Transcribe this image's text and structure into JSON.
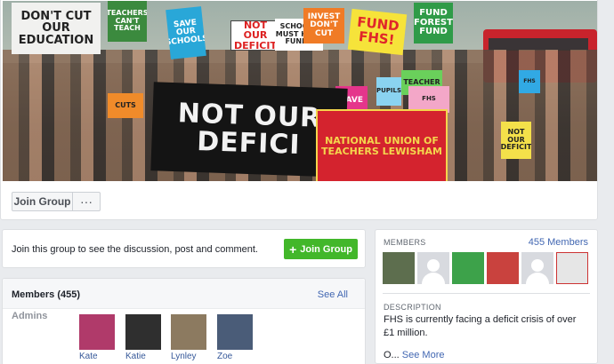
{
  "cover": {
    "banner_lines": [
      "NOT OUR",
      "DEFICI"
    ],
    "union_banner": "NATIONAL UNION OF TEACHERS LEWISHAM",
    "signs": [
      "DON'T CUT OUR EDUCATION",
      "TEACHERS CAN'T TEACH",
      "SAVE OUR SCHOOLS",
      "NOT OUR DEFICIT",
      "SCHOOLS MUST HAVE FUNDS",
      "INVEST DON'T CUT",
      "FUND FHS!",
      "FUND FOREST FUND",
      "CUTS",
      "SAVE",
      "PUPILS",
      "TEACHER",
      "NOT OUR DEFICIT",
      "FHS",
      "FHS"
    ]
  },
  "actions": {
    "join_group": "Join Group",
    "more": "···"
  },
  "join_prompt": {
    "text": "Join this group to see the discussion, post and comment.",
    "button": "Join Group",
    "button_icon": "+"
  },
  "members": {
    "title": "Members (455)",
    "see_all": "See All",
    "admins_label": "Admins",
    "admins": [
      {
        "name": "Kate",
        "color": "#b03a6a"
      },
      {
        "name": "Katie",
        "color": "#2f2f2f"
      },
      {
        "name": "Lynley",
        "color": "#8c7a60"
      },
      {
        "name": "Zoe",
        "color": "#4a5c78"
      }
    ]
  },
  "sidebar": {
    "members_label": "MEMBERS",
    "members_count": "455 Members",
    "thumbs": [
      "photo",
      "generic",
      "photo",
      "photo",
      "generic",
      "photo"
    ],
    "description_label": "DESCRIPTION",
    "description": "FHS is currently facing a deficit crisis of over £1 million.",
    "more_prefix": "O...",
    "see_more": "See More"
  }
}
